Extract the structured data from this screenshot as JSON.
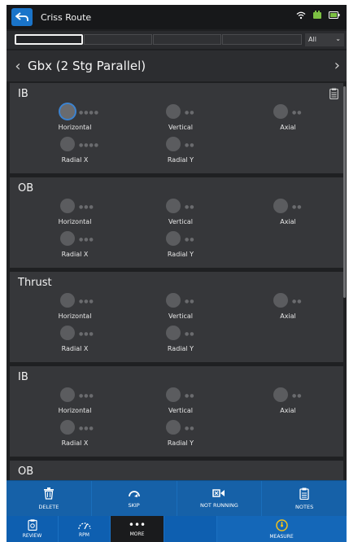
{
  "statusbar": {
    "route_title": "Criss Route"
  },
  "filter": {
    "selected": "All"
  },
  "asset": {
    "title": "Gbx (2 Stg Parallel)"
  },
  "sections": [
    {
      "title": "IB",
      "points": [
        "Horizontal",
        "Vertical",
        "Axial",
        "Radial X",
        "Radial Y"
      ]
    },
    {
      "title": "OB",
      "points": [
        "Horizontal",
        "Vertical",
        "Axial",
        "Radial X",
        "Radial Y"
      ]
    },
    {
      "title": "Thrust",
      "points": [
        "Horizontal",
        "Vertical",
        "Axial",
        "Radial X",
        "Radial Y"
      ]
    },
    {
      "title": "IB",
      "points": [
        "Horizontal",
        "Vertical",
        "Axial",
        "Radial X",
        "Radial Y"
      ]
    },
    {
      "title": "OB",
      "points": []
    }
  ],
  "actions": {
    "delete": "DELETE",
    "skip": "SKIP",
    "not_running": "NOT RUNNING",
    "notes": "NOTES"
  },
  "nav": {
    "review": "REVIEW",
    "rpm": "RPM",
    "more": "MORE",
    "measure": "MEASURE"
  },
  "colors": {
    "accent": "#1a74c9",
    "panel": "#36373a",
    "background": "#1f2022",
    "selected_ring": "#3c83d0"
  }
}
